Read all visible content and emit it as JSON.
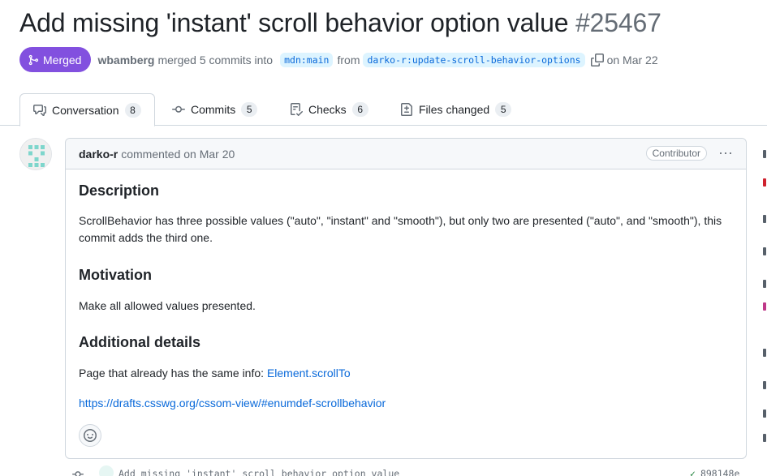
{
  "pr": {
    "title": "Add missing 'instant' scroll behavior option value",
    "number": "#25467",
    "state": "Merged",
    "author": "wbamberg",
    "merged_text": "merged 5 commits into",
    "base_branch": "mdn:main",
    "from_text": "from",
    "head_branch": "darko-r:update-scroll-behavior-options",
    "date_text": "on Mar 22"
  },
  "tabs": [
    {
      "label": "Conversation",
      "count": "8",
      "icon": "comment-discussion-icon"
    },
    {
      "label": "Commits",
      "count": "5",
      "icon": "git-commit-icon"
    },
    {
      "label": "Checks",
      "count": "6",
      "icon": "checklist-icon"
    },
    {
      "label": "Files changed",
      "count": "5",
      "icon": "file-diff-icon"
    }
  ],
  "comment": {
    "author": "darko-r",
    "action": "commented on Mar 20",
    "role": "Contributor",
    "menu": "···",
    "h_description": "Description",
    "p_description": "ScrollBehavior has three possible values (\"auto\", \"instant\" and \"smooth\"), but only two are presented (\"auto\", and \"smooth\"), this commit adds the third one.",
    "h_motivation": "Motivation",
    "p_motivation": "Make all allowed values presented.",
    "h_additional": "Additional details",
    "p_additional_prefix": "Page that already has the same info: ",
    "p_additional_link": "Element.scrollTo",
    "spec_link": "https://drafts.csswg.org/cssom-view/#enumdef-scrollbehavior"
  },
  "timeline": {
    "commit_message": "Add missing 'instant' scroll behavior option value",
    "sha": "898148e"
  },
  "colors": {
    "merged": "#8250df",
    "link": "#0969da",
    "success": "#1a7f37"
  }
}
